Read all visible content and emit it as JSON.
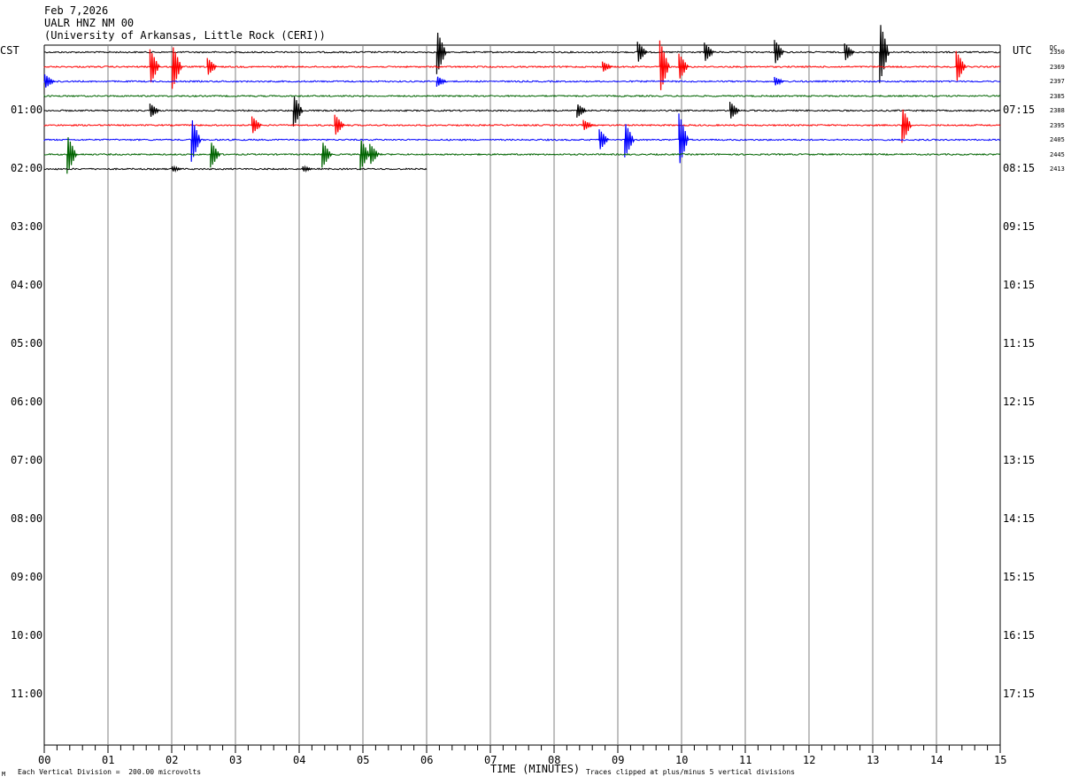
{
  "header": {
    "date": "Feb 7,2026",
    "station": "UALR HNZ NM 00",
    "institution": "(University of Arkansas, Little Rock (CERI))"
  },
  "left_axis_label": "CST",
  "right_axis_label": "UTC",
  "dc_label": "DC",
  "footer": {
    "xlabel": "TIME (MINUTES)",
    "scale_note": "Each Vertical Division =  200.00 microvolts",
    "clip_note": "Traces clipped at plus/minus 5 vertical divisions",
    "corner_mark": "M"
  },
  "colors": {
    "black": "#000000",
    "red": "#ff0000",
    "blue": "#0000ff",
    "green": "#006400",
    "grid": "#808080"
  },
  "chart_data": {
    "type": "line",
    "title": "UALR HNZ NM 00",
    "xlabel": "TIME (MINUTES)",
    "xlim": [
      0,
      15
    ],
    "x_ticks": [
      "00",
      "01",
      "02",
      "03",
      "04",
      "05",
      "06",
      "07",
      "08",
      "09",
      "10",
      "11",
      "12",
      "13",
      "14",
      "15"
    ],
    "cst_labels": [
      "01:00",
      "02:00",
      "03:00",
      "04:00",
      "05:00",
      "06:00",
      "07:00",
      "08:00",
      "09:00",
      "10:00",
      "11:00"
    ],
    "utc_labels": [
      "07:15",
      "08:15",
      "09:15",
      "10:15",
      "11:15",
      "12:15",
      "13:15",
      "14:15",
      "15:15",
      "16:15",
      "17:15"
    ],
    "rows_per_hour": 4,
    "row_minutes": 15,
    "traces": [
      {
        "row": 0,
        "color": "black",
        "dc": "2350",
        "end_minute": 15,
        "events": [
          {
            "t": 6.2,
            "amp": -2.5
          },
          {
            "t": 9.35,
            "amp": 1.2
          },
          {
            "t": 10.4,
            "amp": 1.1
          },
          {
            "t": 11.5,
            "amp": 1.4
          },
          {
            "t": 12.6,
            "amp": 1.0
          },
          {
            "t": 13.15,
            "amp": -3.5
          }
        ]
      },
      {
        "row": 1,
        "color": "red",
        "dc": "2369",
        "end_minute": 15,
        "events": [
          {
            "t": 1.7,
            "amp": 2.0
          },
          {
            "t": 2.05,
            "amp": -2.5
          },
          {
            "t": 2.6,
            "amp": 1.0
          },
          {
            "t": 8.8,
            "amp": 0.6
          },
          {
            "t": 9.7,
            "amp": 3.0
          },
          {
            "t": 10.0,
            "amp": 1.5
          },
          {
            "t": 14.35,
            "amp": 1.8
          }
        ]
      },
      {
        "row": 2,
        "color": "blue",
        "dc": "2397",
        "end_minute": 15,
        "events": [
          {
            "t": 0.05,
            "amp": 0.8
          },
          {
            "t": 6.2,
            "amp": -0.6
          },
          {
            "t": 11.5,
            "amp": 0.5
          }
        ]
      },
      {
        "row": 3,
        "color": "green",
        "dc": "2385",
        "end_minute": 15,
        "events": []
      },
      {
        "row": 4,
        "color": "black",
        "dc": "2388",
        "end_minute": 15,
        "events": [
          {
            "t": 1.7,
            "amp": 0.8
          },
          {
            "t": 3.95,
            "amp": -1.8
          },
          {
            "t": 8.4,
            "amp": -0.8
          },
          {
            "t": 10.8,
            "amp": 1.0
          }
        ]
      },
      {
        "row": 5,
        "color": "red",
        "dc": "2395",
        "end_minute": 15,
        "events": [
          {
            "t": 3.3,
            "amp": 1.0
          },
          {
            "t": 4.6,
            "amp": 1.2
          },
          {
            "t": 8.5,
            "amp": 0.6
          },
          {
            "t": 13.5,
            "amp": -2.0
          }
        ]
      },
      {
        "row": 6,
        "color": "blue",
        "dc": "2405",
        "end_minute": 15,
        "events": [
          {
            "t": 2.35,
            "amp": -2.5
          },
          {
            "t": 8.75,
            "amp": 1.2
          },
          {
            "t": 9.15,
            "amp": -2.0
          },
          {
            "t": 10.0,
            "amp": 3.0
          }
        ]
      },
      {
        "row": 7,
        "color": "green",
        "dc": "2445",
        "end_minute": 15,
        "events": [
          {
            "t": 0.4,
            "amp": -2.2
          },
          {
            "t": 2.65,
            "amp": -1.5
          },
          {
            "t": 4.4,
            "amp": -1.5
          },
          {
            "t": 5.0,
            "amp": -1.8
          },
          {
            "t": 5.15,
            "amp": 1.2
          }
        ]
      },
      {
        "row": 8,
        "color": "black",
        "dc": "2413",
        "end_minute": 6,
        "events": [
          {
            "t": 2.05,
            "amp": 0.3
          },
          {
            "t": 4.1,
            "amp": 0.3
          }
        ]
      }
    ]
  }
}
